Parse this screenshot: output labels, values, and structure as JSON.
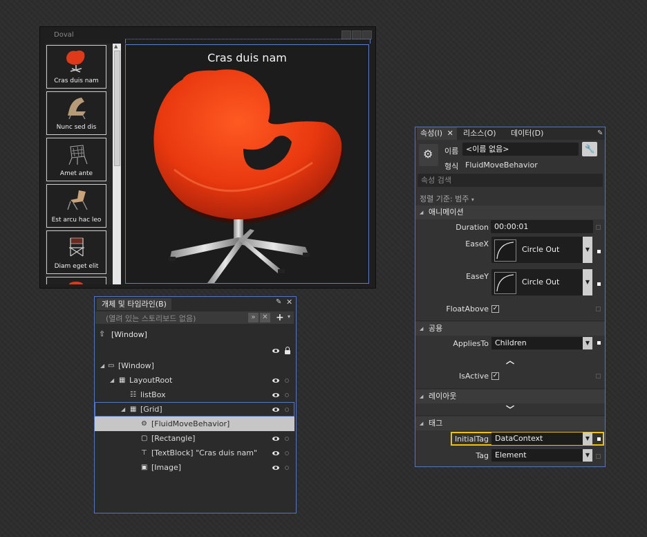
{
  "window": {
    "title": "Doval",
    "list_items": [
      {
        "label": "Cras duis nam",
        "icon": "red-swan-chair-icon"
      },
      {
        "label": "Nunc sed dis",
        "icon": "lounge-chair-icon"
      },
      {
        "label": "Amet ante",
        "icon": "wire-chair-icon"
      },
      {
        "label": "Est arcu hac leo",
        "icon": "sling-chair-icon"
      },
      {
        "label": "Diam eget elit",
        "icon": "director-chair-icon"
      }
    ],
    "preview_title": "Cras duis nam"
  },
  "objects_panel": {
    "tab_label": "개체 및 타임라인(B)",
    "storyboard_placeholder": "(열려 있는 스토리보드 없음)",
    "scope_label": "[Window]",
    "tree": [
      {
        "label": "[Window]",
        "icon": "window-icon"
      },
      {
        "label": "LayoutRoot",
        "icon": "grid-icon"
      },
      {
        "label": "listBox",
        "icon": "listbox-icon"
      },
      {
        "label": "[Grid]",
        "icon": "grid-icon"
      },
      {
        "label": "[FluidMoveBehavior]",
        "icon": "behavior-gear-icon"
      },
      {
        "label": "[Rectangle]",
        "icon": "rectangle-icon"
      },
      {
        "label": "[TextBlock] \"Cras duis nam\"",
        "icon": "textblock-icon"
      },
      {
        "label": "[Image]",
        "icon": "image-icon"
      }
    ]
  },
  "properties_panel": {
    "tabs": [
      "속성(I)",
      "리소스(O)",
      "데이터(D)"
    ],
    "name_label": "이름",
    "name_value": "<이름 없음>",
    "type_label": "형식",
    "type_value": "FluidMoveBehavior",
    "search_placeholder": "속성 검색",
    "sort_label": "정렬 기준: 범주",
    "sections": {
      "animation": "애니메이션",
      "common": "공용",
      "layout": "레이아웃",
      "tag": "태그"
    },
    "props": {
      "duration_label": "Duration",
      "duration_value": "00:00:01",
      "easex_label": "EaseX",
      "easex_value": "Circle Out",
      "easey_label": "EaseY",
      "easey_value": "Circle Out",
      "floatabove_label": "FloatAbove",
      "floatabove_checked": true,
      "appliesto_label": "AppliesTo",
      "appliesto_value": "Children",
      "isactive_label": "IsActive",
      "isactive_checked": true,
      "initialtag_label": "InitialTag",
      "initialtag_value": "DataContext",
      "tag_label": "Tag",
      "tag_value": "Element"
    },
    "check_glyph": "✓",
    "highlight_color": "#f2c200"
  }
}
